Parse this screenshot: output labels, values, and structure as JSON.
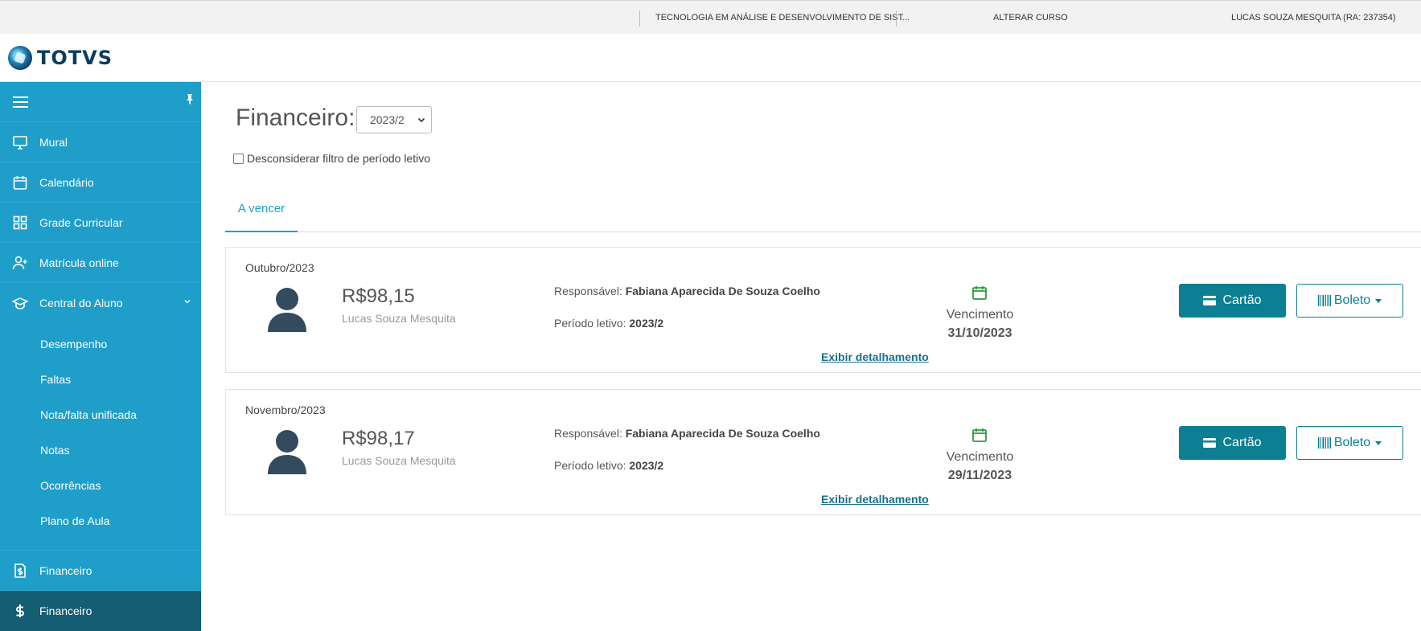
{
  "topbar": {
    "course": "TECNOLOGIA EM ANÁLISE E DESENVOLVIMENTO DE SIST...",
    "change_course": "ALTERAR CURSO",
    "user": "LUCAS SOUZA MESQUITA (RA: 237354)"
  },
  "brand": {
    "name": "TOTVS"
  },
  "sidebar": {
    "items": [
      {
        "label": "Mural",
        "icon": "monitor-icon"
      },
      {
        "label": "Calendário",
        "icon": "calendar-icon"
      },
      {
        "label": "Grade Curricular",
        "icon": "grid-icon"
      },
      {
        "label": "Matrícula online",
        "icon": "user-plus-icon"
      },
      {
        "label": "Central do Aluno",
        "icon": "graduation-cap-icon"
      }
    ],
    "sub_items": [
      {
        "label": "Desempenho"
      },
      {
        "label": "Faltas"
      },
      {
        "label": "Nota/falta unificada"
      },
      {
        "label": "Notas"
      },
      {
        "label": "Ocorrências"
      },
      {
        "label": "Plano de Aula"
      }
    ],
    "bottom_items": [
      {
        "label": "Financeiro",
        "icon": "invoice-dollar-icon"
      },
      {
        "label": "Financeiro",
        "icon": "dollar-icon",
        "active": true
      }
    ]
  },
  "main": {
    "title": "Financeiro:",
    "period_select": {
      "value": "2023/2"
    },
    "ignore_filter_label": "Desconsiderar filtro de período letivo",
    "tabs": [
      {
        "label": "A vencer"
      }
    ],
    "cards": [
      {
        "month": "Outubro/2023",
        "amount": "R$98,15",
        "student": "Lucas Souza Mesquita",
        "responsible_label": "Responsável:",
        "responsible": "Fabiana Aparecida De Souza Coelho",
        "period_label": "Período letivo:",
        "period": "2023/2",
        "due_label": "Vencimento",
        "due_date": "31/10/2023",
        "details": "Exibir detalhamento",
        "card_button": "Cartão",
        "boleto_button": "Boleto"
      },
      {
        "month": "Novembro/2023",
        "amount": "R$98,17",
        "student": "Lucas Souza Mesquita",
        "responsible_label": "Responsável:",
        "responsible": "Fabiana Aparecida De Souza Coelho",
        "period_label": "Período letivo:",
        "period": "2023/2",
        "due_label": "Vencimento",
        "due_date": "29/11/2023",
        "details": "Exibir detalhamento",
        "card_button": "Cartão",
        "boleto_button": "Boleto"
      }
    ]
  },
  "colors": {
    "sidebar": "#1f9ec9",
    "sidebar_active": "#145d72",
    "primary_button": "#0c7f93",
    "calendar_green": "#2e9a3a"
  }
}
